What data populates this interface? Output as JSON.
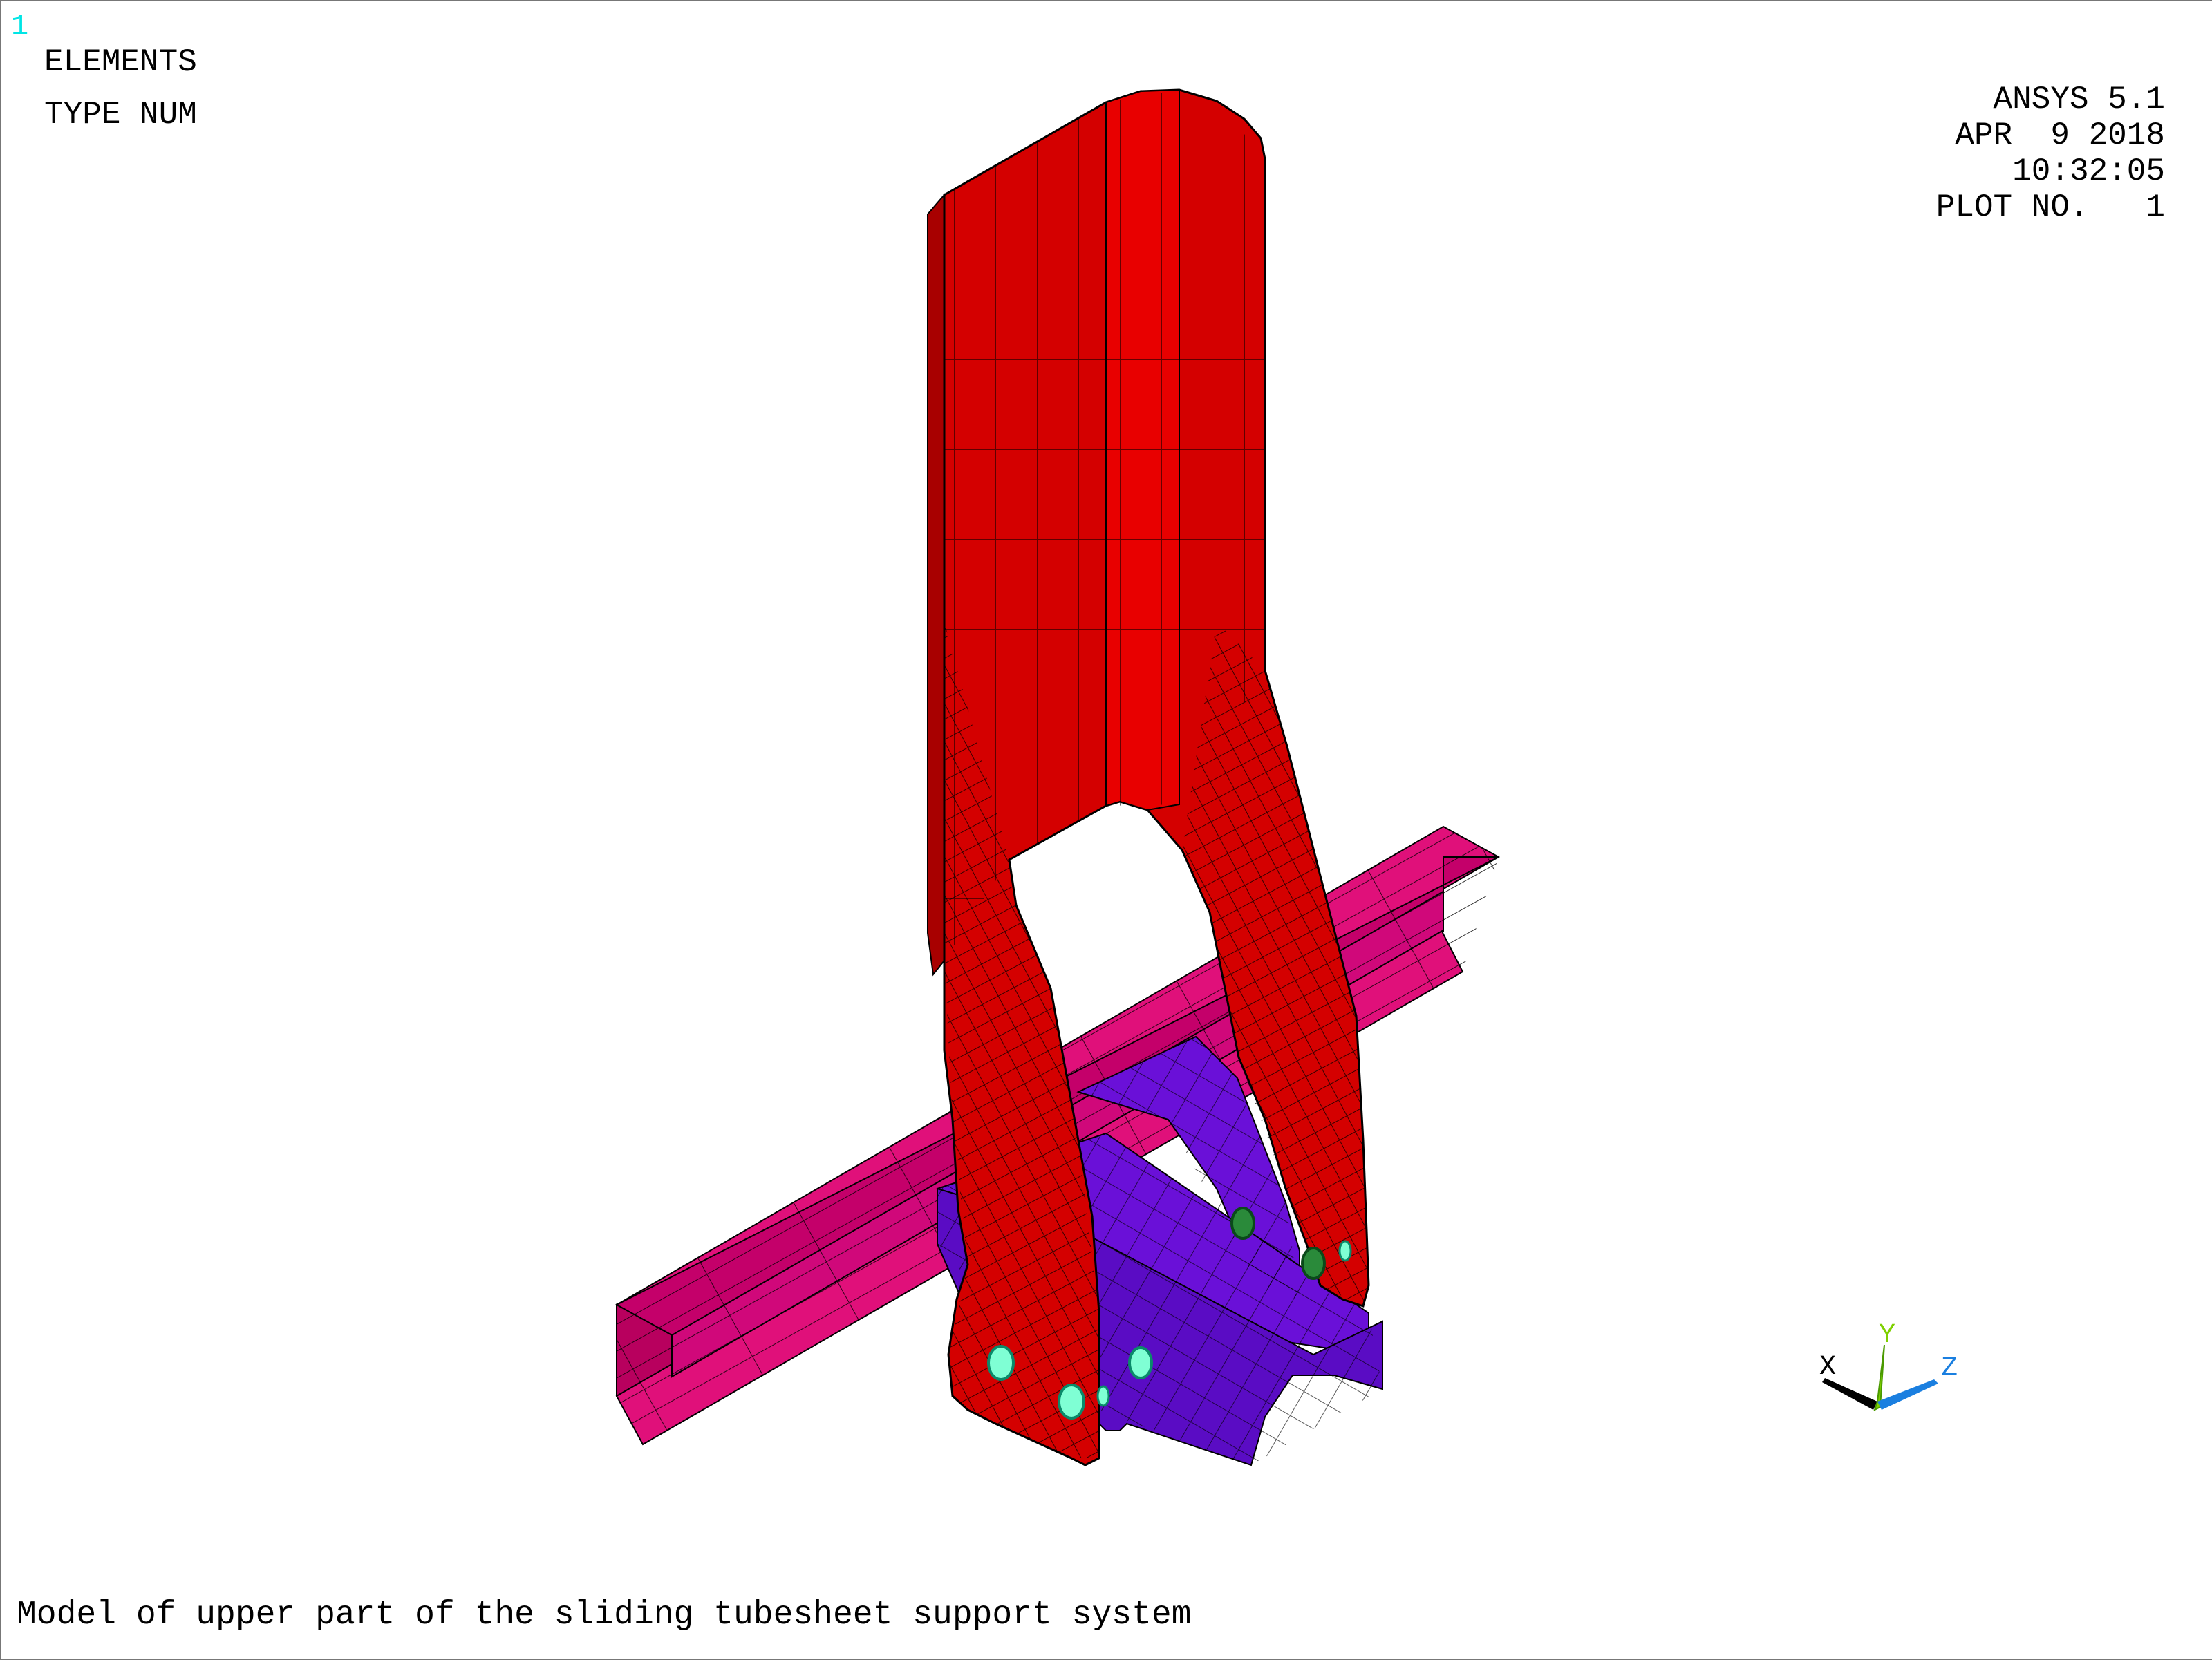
{
  "window_number": "1",
  "plot_type": {
    "line1": "ELEMENTS",
    "line2": "TYPE NUM"
  },
  "info": {
    "program": "ANSYS 5.1",
    "date": "APR  9 2018",
    "time": "10:32:05",
    "plot_no": "PLOT NO.   1"
  },
  "triad": {
    "x_label": "X",
    "y_label": "Y",
    "z_label": "Z"
  },
  "caption": "Model of upper part of the sliding tubesheet support system",
  "colors": {
    "bracket": "#d40000",
    "bracket_dark": "#a80000",
    "beam": "#e0107a",
    "beam_dark": "#b8005e",
    "clamp": "#6a10d8",
    "clamp_dark": "#5008b0",
    "bolt": "#7fffd4",
    "mesh_line": "#000000",
    "triad_x": "#000000",
    "triad_y": "#7fd000",
    "triad_z": "#1a7fe0",
    "window_number": "#00e5e5"
  }
}
